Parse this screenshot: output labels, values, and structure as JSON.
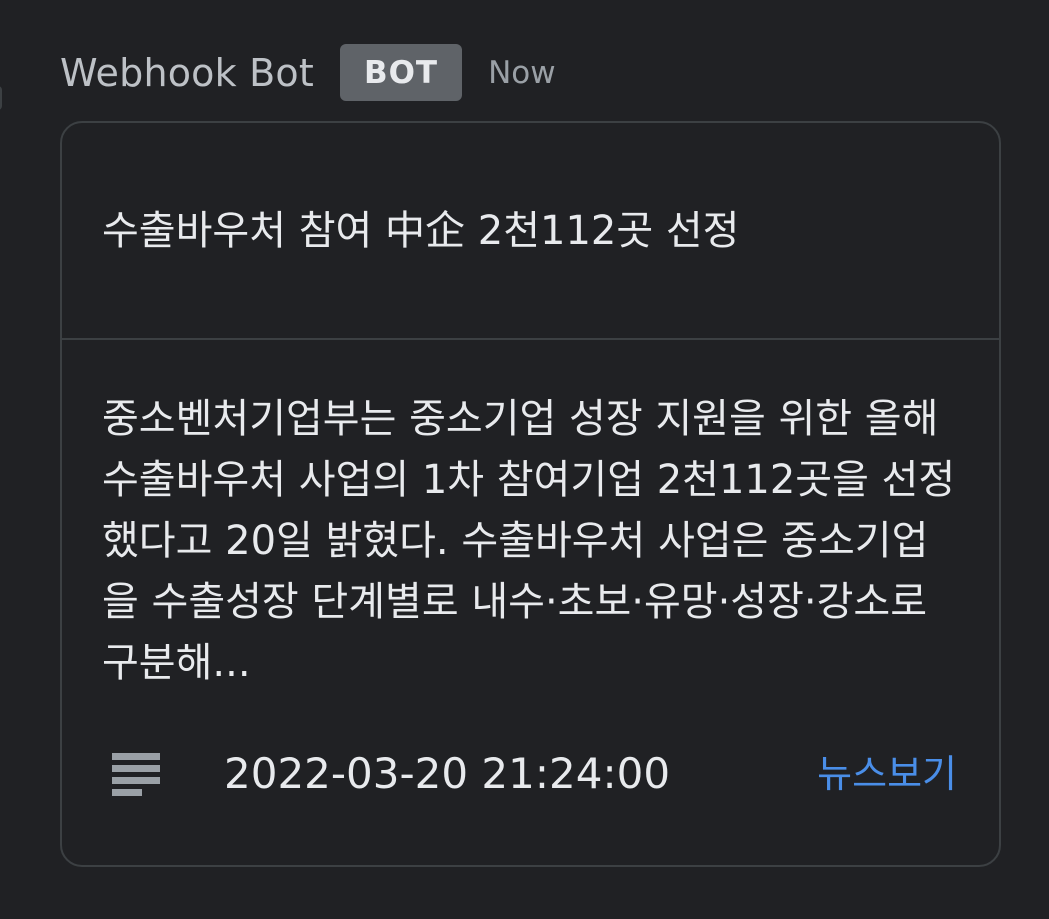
{
  "message": {
    "sender": "Webhook Bot",
    "badge": "BOT",
    "time": "Now"
  },
  "card": {
    "title": "수출바우처 참여 中企 2천112곳 선정",
    "body": "중소벤처기업부는 중소기업 성장 지원을 위한 올해 수출바우처 사업의 1차 참여기업 2천112곳을 선정했다고 20일 밝혔다. 수출바우처 사업은 중소기업을 수출성장 단계별로 내수·초보·유망·성장·강소로 구분해...",
    "timestamp": "2022-03-20 21:24:00",
    "link_label": "뉴스보기",
    "icon": "list-icon"
  },
  "colors": {
    "background": "#202124",
    "badge_background": "#5f6368",
    "link": "#4a8ee8",
    "border": "#3c4043"
  }
}
